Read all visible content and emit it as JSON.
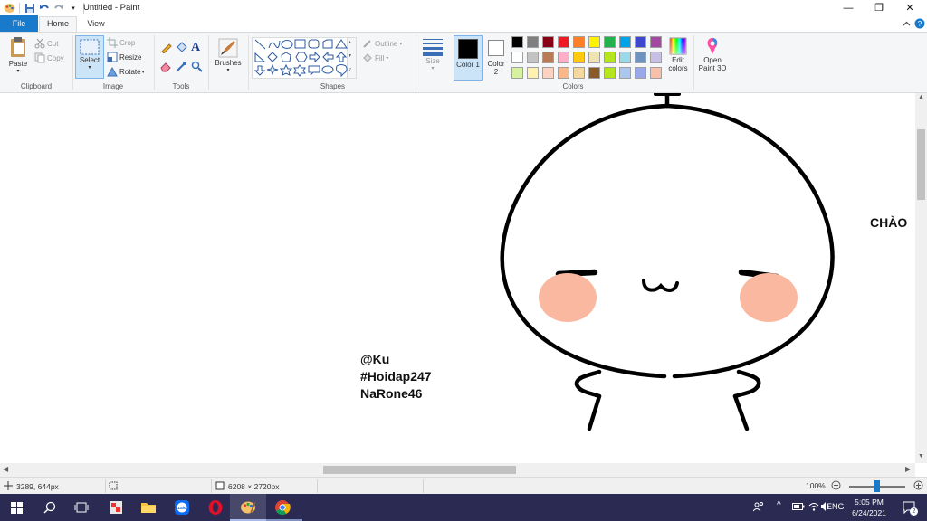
{
  "window": {
    "title": "Untitled - Paint",
    "controls": {
      "minimize": "—",
      "maximize": "❐",
      "close": "✕"
    }
  },
  "tabs": [
    {
      "label": "File"
    },
    {
      "label": "Home"
    },
    {
      "label": "View"
    }
  ],
  "ribbon": {
    "clipboard": {
      "label": "Clipboard",
      "paste": "Paste",
      "cut": "Cut",
      "copy": "Copy"
    },
    "image": {
      "label": "Image",
      "select": "Select",
      "crop": "Crop",
      "resize": "Resize",
      "rotate": "Rotate"
    },
    "tools": {
      "label": "Tools"
    },
    "brushes": {
      "label": "Brushes"
    },
    "shapes": {
      "label": "Shapes",
      "outline": "Outline",
      "fill": "Fill"
    },
    "size": {
      "label": "Size"
    },
    "colors": {
      "label": "Colors",
      "color1": "Color 1",
      "color2": "Color 2",
      "edit_colors": "Edit colors",
      "open_paint3d": "Open Paint 3D",
      "color1_value": "#000000",
      "color2_value": "#ffffff",
      "palette_row1": [
        "#000000",
        "#7f7f7f",
        "#880015",
        "#ed1c24",
        "#ff7f27",
        "#fff200",
        "#22b14c",
        "#00a2e8",
        "#3f48cc",
        "#a349a4"
      ],
      "palette_row2": [
        "#ffffff",
        "#c3c3c3",
        "#b97a57",
        "#ffaec9",
        "#ffc90e",
        "#efe4b0",
        "#b5e61d",
        "#99d9ea",
        "#7092be",
        "#c8bfe7"
      ],
      "palette_row3": [
        "#d6f2a0",
        "#fff2b0",
        "#fcd3c1",
        "#f8b88b",
        "#f5d8a0",
        "#8b5a2b",
        "#b5e61d",
        "#a8c8f0",
        "#98a8e8",
        "#f8c0a8"
      ]
    }
  },
  "canvas": {
    "texts": [
      "@Ku",
      "#Hoidap247",
      "NaRone46"
    ],
    "greeting": "CHÀO",
    "blush_color": "#fbb8a0"
  },
  "status": {
    "cursor_pos": "3289, 644px",
    "image_size": "6208 × 2720px",
    "zoom": "100%",
    "zoom_level_fraction": 0.5
  },
  "taskbar": {
    "lang": "ENG",
    "time": "5:05 PM",
    "date": "6/24/2021",
    "notification_count": "2",
    "active_app": "paint"
  }
}
